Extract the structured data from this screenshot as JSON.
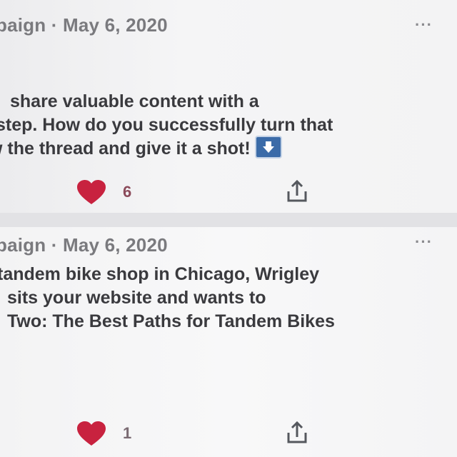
{
  "posts": [
    {
      "header": "paign · May 6, 2020",
      "more_label": "···",
      "lines": [
        "share valuable content with a",
        "step. How do you successfully turn that",
        "w the thread and give it a shot!"
      ],
      "emoji": "down-arrow-emoji",
      "like_count": "6",
      "colors": {
        "heart": "#c8223f",
        "emoji": "#3b6ba8"
      }
    },
    {
      "header": "paign · May 6, 2020",
      "more_label": "···",
      "lines": [
        "tandem bike shop in Chicago, Wrigley",
        "sits your website and wants to",
        "Two: The Best Paths for Tandem Bikes"
      ],
      "like_count": "1",
      "colors": {
        "heart": "#c8223f"
      }
    }
  ]
}
